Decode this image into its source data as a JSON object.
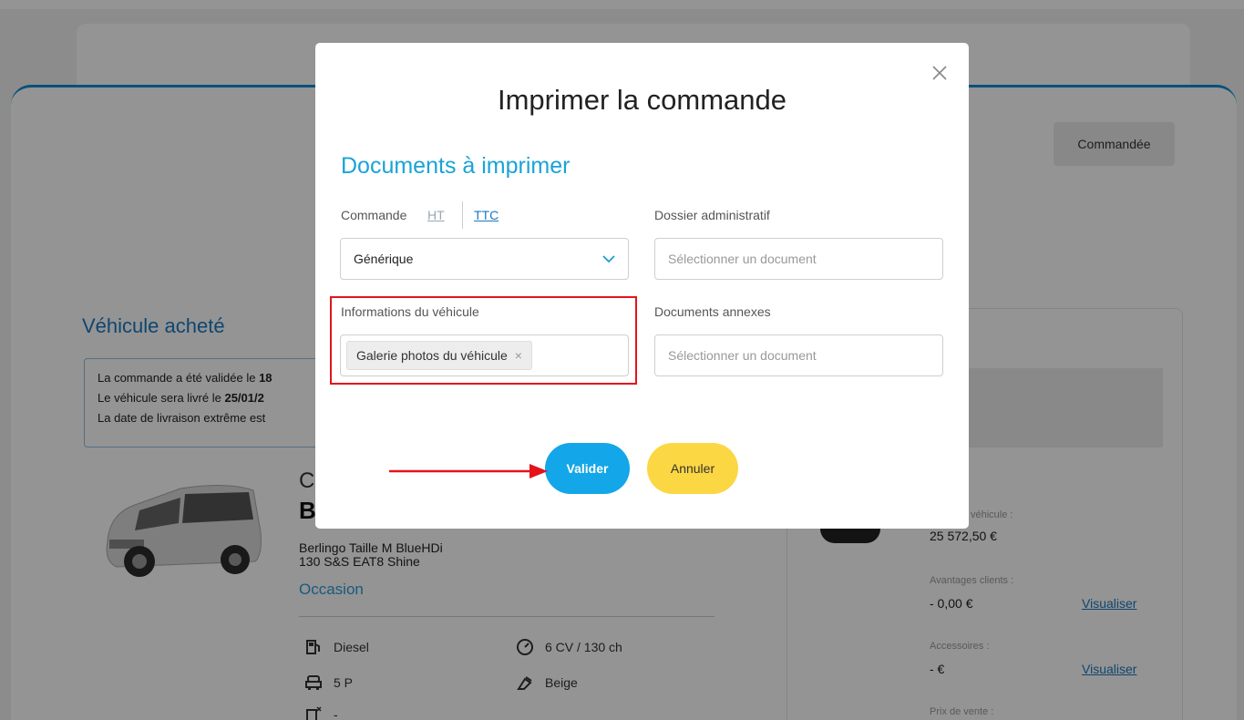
{
  "background": {
    "status_badge": "Commandée",
    "section_title": "Véhicule acheté",
    "info_lines": [
      {
        "prefix": "La commande a été validée le ",
        "bold": "18"
      },
      {
        "prefix": "Le véhicule sera livré le ",
        "bold": "25/01/2"
      },
      {
        "prefix": "La date de livraison extrême est",
        "bold": ""
      }
    ],
    "car": {
      "brand_initial": "C",
      "model_initial": "B",
      "version_line1": "Berlingo Taille M BlueHDi",
      "version_line2": "130 S&S EAT8 Shine",
      "condition": "Occasion",
      "specs": {
        "fuel": "Diesel",
        "power": "6 CV / 130 ch",
        "doors": "5 P",
        "color": "Beige",
        "co2": "-"
      }
    },
    "pricing": {
      "vehicle_price_label": "véhicule :",
      "vehicle_price": "25 572,50 €",
      "advantages_label": "Avantages clients :",
      "advantages_value": "- 0,00 €",
      "accessories_label": "Accessoires :",
      "accessories_value": "- €",
      "sale_price_label": "Prix de vente :",
      "view_link": "Visualiser"
    }
  },
  "modal": {
    "title": "Imprimer la commande",
    "subtitle": "Documents à imprimer",
    "close_icon": "close-icon",
    "order": {
      "label": "Commande",
      "tab_ht": "HT",
      "tab_ttc": "TTC",
      "select_value": "Générique"
    },
    "admin_file": {
      "label": "Dossier administratif",
      "placeholder": "Sélectionner un document"
    },
    "vehicle_info": {
      "label": "Informations du véhicule",
      "tag": "Galerie photos du véhicule",
      "tag_remove": "×"
    },
    "annex_docs": {
      "label": "Documents annexes",
      "placeholder": "Sélectionner un document"
    },
    "buttons": {
      "validate": "Valider",
      "cancel": "Annuler"
    }
  },
  "colors": {
    "accent": "#13a6e8",
    "title_blue": "#1aa3d6",
    "cancel_yellow": "#fbd743",
    "annotation_red": "#e3141b"
  }
}
